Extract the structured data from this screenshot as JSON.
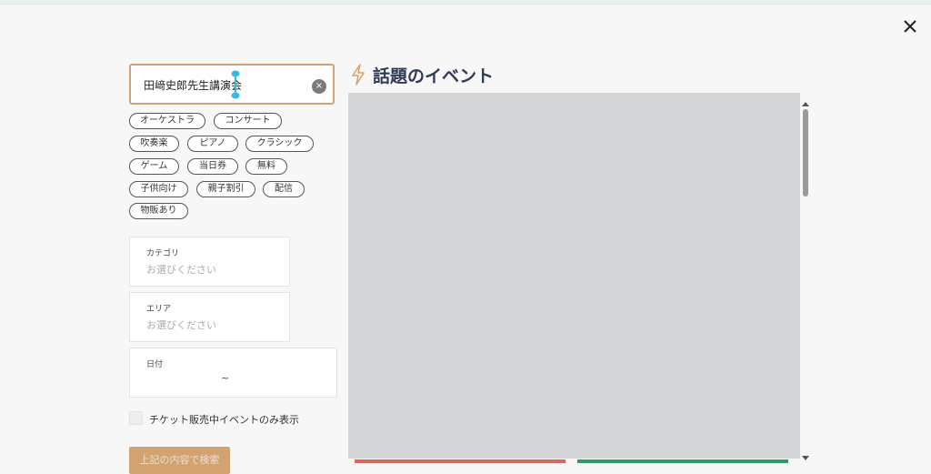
{
  "search": {
    "value": "田﨑史郎先生講演会",
    "clear_symbol": "×"
  },
  "tags": [
    {
      "label": "オーケストラ"
    },
    {
      "label": "コンサート"
    },
    {
      "label": "吹奏楽"
    },
    {
      "label": "ピアノ"
    },
    {
      "label": "クラシック"
    },
    {
      "label": "ゲーム"
    },
    {
      "label": "当日券"
    },
    {
      "label": "無料"
    },
    {
      "label": "子供向け"
    },
    {
      "label": "親子割引"
    },
    {
      "label": "配信"
    },
    {
      "label": "物販あり"
    }
  ],
  "filters": {
    "category": {
      "label": "カテゴリ",
      "placeholder": "お選びください"
    },
    "area": {
      "label": "エリア",
      "placeholder": "お選びください"
    },
    "date": {
      "label": "日付",
      "separator": "~"
    }
  },
  "only_on_sale": {
    "label": "チケット販売中イベントのみ表示",
    "checked": false
  },
  "submit": {
    "label": "上記の内容で検索"
  },
  "featured": {
    "title": "話題のイベント"
  },
  "colors": {
    "accent": "#d3a271",
    "title": "#2f3a55",
    "placeholder_image": "#d4d5d7",
    "red_bar": "#d9675f",
    "green_bar": "#2f9b63"
  }
}
